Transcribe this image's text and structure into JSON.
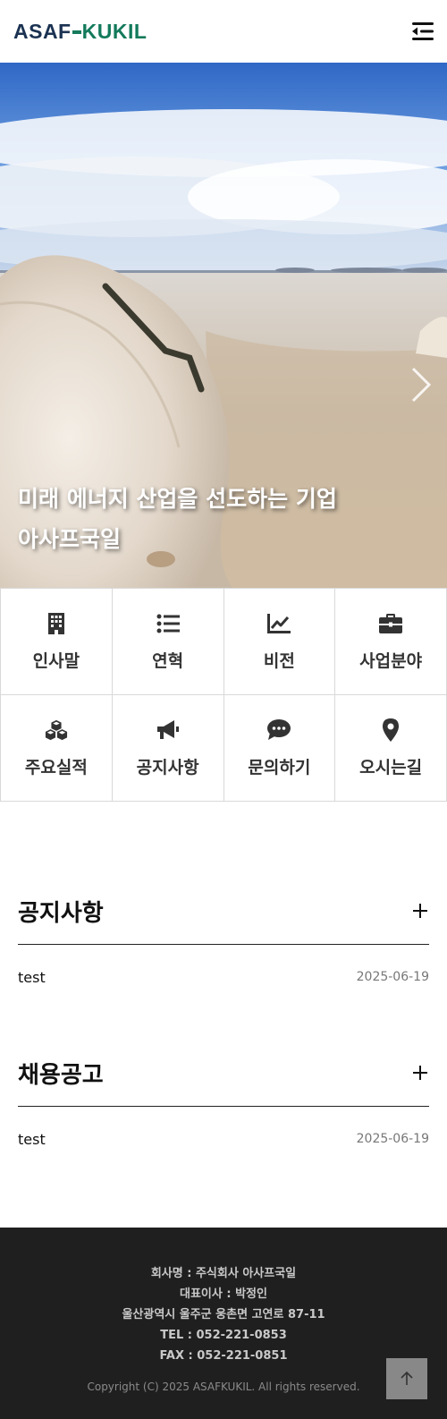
{
  "header": {
    "logo_left": "ASAF",
    "logo_right": "KUKIL",
    "menu_icon": "menu-icon"
  },
  "hero": {
    "line1": "미래 에너지 산업을 선도하는 기업",
    "line2": "아사프국일",
    "next_icon": "chevron-right-icon"
  },
  "quick_menu": [
    {
      "label": "인사말",
      "icon": "building-icon"
    },
    {
      "label": "연혁",
      "icon": "list-icon"
    },
    {
      "label": "비전",
      "icon": "chart-line-icon"
    },
    {
      "label": "사업분야",
      "icon": "briefcase-icon"
    },
    {
      "label": "주요실적",
      "icon": "cubes-icon"
    },
    {
      "label": "공지사항",
      "icon": "megaphone-icon"
    },
    {
      "label": "문의하기",
      "icon": "comment-icon"
    },
    {
      "label": "오시는길",
      "icon": "map-marker-icon"
    }
  ],
  "boards": [
    {
      "title": "공지사항",
      "rows": [
        {
          "subject": "test",
          "date": "2025-06-19"
        }
      ]
    },
    {
      "title": "채용공고",
      "rows": [
        {
          "subject": "test",
          "date": "2025-06-19"
        }
      ]
    }
  ],
  "footer": {
    "company": "회사명 : 주식회사 아사프국일",
    "ceo": "대표이사 : 박정인",
    "address": "울산광역시 울주군 웅촌면 고연로 87-11",
    "tel": "TEL : 052-221-0853",
    "fax": "FAX : 052-221-0851",
    "copyright": "Copyright (C) 2025 ASAFKUKIL. All rights reserved."
  },
  "colors": {
    "logo_navy": "#1b3252",
    "logo_green": "#137a5b",
    "footer_bg": "#1f1f1f",
    "top_button": "#888888"
  }
}
